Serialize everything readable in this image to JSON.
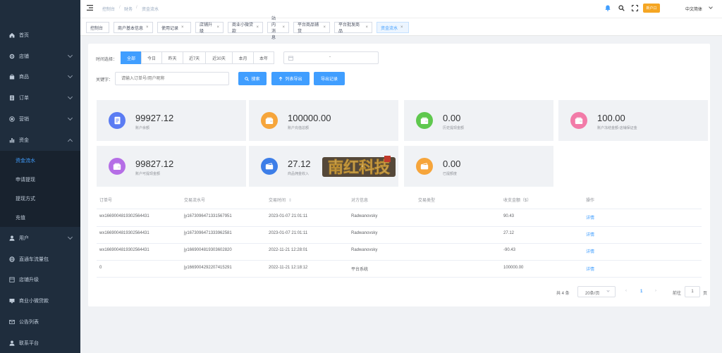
{
  "sidebar": {
    "items": [
      {
        "label": "首页",
        "icon": "home-icon",
        "arrow": false
      },
      {
        "label": "店铺",
        "icon": "gear-icon",
        "arrow": true
      },
      {
        "label": "商品",
        "icon": "bag-icon",
        "arrow": true
      },
      {
        "label": "订单",
        "icon": "list-icon",
        "arrow": true
      },
      {
        "label": "营销",
        "icon": "target-icon",
        "arrow": true
      },
      {
        "label": "资金",
        "icon": "bar-chart-icon",
        "arrow": true,
        "open": true
      },
      {
        "label": "用户",
        "icon": "user-icon",
        "arrow": true
      },
      {
        "label": "直通车流量包",
        "icon": "globe-icon",
        "arrow": false
      },
      {
        "label": "店铺升级",
        "icon": "store-icon",
        "arrow": false
      },
      {
        "label": "商业小微贷款",
        "icon": "monitor-icon",
        "arrow": false
      },
      {
        "label": "公告列表",
        "icon": "mail-icon",
        "arrow": false
      },
      {
        "label": "联系平台",
        "icon": "user-icon",
        "arrow": false
      }
    ],
    "subitems": [
      {
        "label": "资金流水",
        "active": true
      },
      {
        "label": "申请提现",
        "active": false
      },
      {
        "label": "提现方式",
        "active": false
      },
      {
        "label": "充值",
        "active": false
      }
    ]
  },
  "topbar": {
    "breadcrumb": [
      "控制台",
      "财务",
      "资金流水"
    ],
    "hot_badge": "新户口",
    "language": "中文简体"
  },
  "tags": [
    {
      "label": "控制台",
      "closable": false,
      "active": false
    },
    {
      "label": "商户基本信息",
      "closable": true,
      "active": false
    },
    {
      "label": "使用记录",
      "closable": true,
      "active": false
    },
    {
      "label": "店铺升级",
      "closable": true,
      "active": false
    },
    {
      "label": "商业小微贷款",
      "closable": true,
      "active": false
    },
    {
      "label": "站内消息",
      "closable": true,
      "active": false
    },
    {
      "label": "平台商品铺货",
      "closable": true,
      "active": false
    },
    {
      "label": "平台批发商品",
      "closable": true,
      "active": false
    },
    {
      "label": "资金流水",
      "closable": true,
      "active": true
    }
  ],
  "filters": {
    "time_label": "时间选择：",
    "time_options": [
      "全部",
      "今日",
      "昨天",
      "近7天",
      "近30天",
      "本月",
      "本年"
    ],
    "time_selected": "全部",
    "date_separator": "-",
    "keyword_label": "关键字：",
    "keyword_placeholder": "请输入订单号/用户昵称",
    "search_btn": "搜索",
    "export_list_btn": "列表导出",
    "export_record_btn": "导出记录"
  },
  "cards": [
    {
      "value": "99927.12",
      "label": "账户余额",
      "color": "#5b7cf3",
      "icon": "document-icon"
    },
    {
      "value": "100000.00",
      "label": "账户充值总额",
      "color": "#f6a53b",
      "icon": "wallet-icon"
    },
    {
      "value": "0.00",
      "label": "历史提现金额",
      "color": "#5fc84e",
      "icon": "wallet-icon"
    },
    {
      "value": "100.00",
      "label": "账户冻结金额-店铺保证金",
      "color": "#f27ba8",
      "icon": "wallet-icon"
    },
    {
      "value": "99827.12",
      "label": "账户可提现金额",
      "color": "#b56ee6",
      "icon": "wallet-icon"
    },
    {
      "value": "27.12",
      "label": "商品佣金收入",
      "color": "#3d7ee8",
      "icon": "card-icon"
    },
    {
      "value": "0.00",
      "label": "已提额度",
      "color": "#f6a53b",
      "icon": "card-icon"
    }
  ],
  "watermark": "南红科技",
  "table": {
    "headers": [
      "订单号",
      "交易流水号",
      "交易时间",
      "对方信息",
      "交易类型",
      "收支金额（$）",
      "操作"
    ],
    "rows": [
      [
        "wx1669004819302564431",
        "jy1673096471331567951",
        "2023-01-07 21:01:11",
        "Radwanovsky",
        "",
        "90.43",
        "详情"
      ],
      [
        "wx1669004819302564431",
        "jy1673096471333962581",
        "2023-01-07 21:01:11",
        "Radwanovsky",
        "",
        "27.12",
        "详情"
      ],
      [
        "wx1669004819302564431",
        "jy1669004819303602820",
        "2022-11-21 12:28:01",
        "Radwanovsky",
        "",
        "-90.43",
        "详情"
      ],
      [
        "0",
        "jy1669004292207415291",
        "2022-11-21 12:18:12",
        "平台系统",
        "",
        "100000.00",
        "详情"
      ]
    ]
  },
  "pagination": {
    "total": "共 4 条",
    "page_size": "20条/页",
    "current_page": "1",
    "goto_label": "前往",
    "goto_value": "1",
    "page_suffix": "页"
  },
  "colors": {
    "primary": "#409eff",
    "sidebar_bg": "#1f2d3d",
    "badge": "#f5a623"
  }
}
